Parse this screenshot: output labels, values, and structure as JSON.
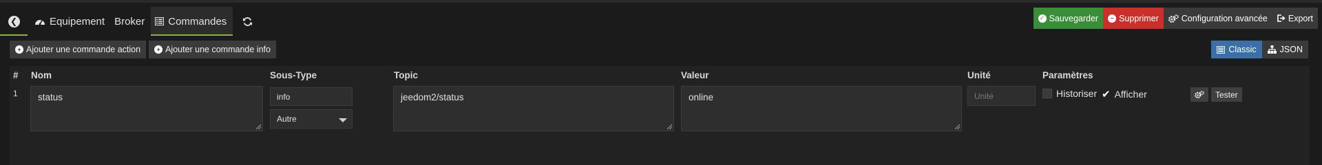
{
  "tabs": {
    "back_icon": "arrow-left-circle-icon",
    "equipment_label": "Equipement",
    "broker_label": "Broker",
    "commands_label": "Commandes",
    "refresh_icon": "refresh-icon"
  },
  "actions": {
    "save_label": "Sauvegarder",
    "delete_label": "Supprimer",
    "config_label": "Configuration avancée",
    "export_label": "Export",
    "save_color": "#3a8e3a",
    "delete_color": "#c9302c"
  },
  "add_buttons": {
    "action_label": "Ajouter une commande action",
    "info_label": "Ajouter une commande info"
  },
  "view_toggle": {
    "classic_label": "Classic",
    "json_label": "JSON",
    "active_color": "#3a6fa8"
  },
  "table": {
    "headers": {
      "num": "#",
      "name": "Nom",
      "subtype": "Sous-Type",
      "topic": "Topic",
      "value": "Valeur",
      "unit": "Unité",
      "params": "Paramètres"
    },
    "rows": [
      {
        "num": "1",
        "name": "status",
        "type": "info",
        "subtype": "Autre",
        "topic": "jeedom2/status",
        "value": "online",
        "unit_placeholder": "Unité",
        "historize_label": "Historiser",
        "historize_checked": false,
        "display_label": "Afficher",
        "display_checked": true,
        "test_label": "Tester"
      }
    ]
  }
}
